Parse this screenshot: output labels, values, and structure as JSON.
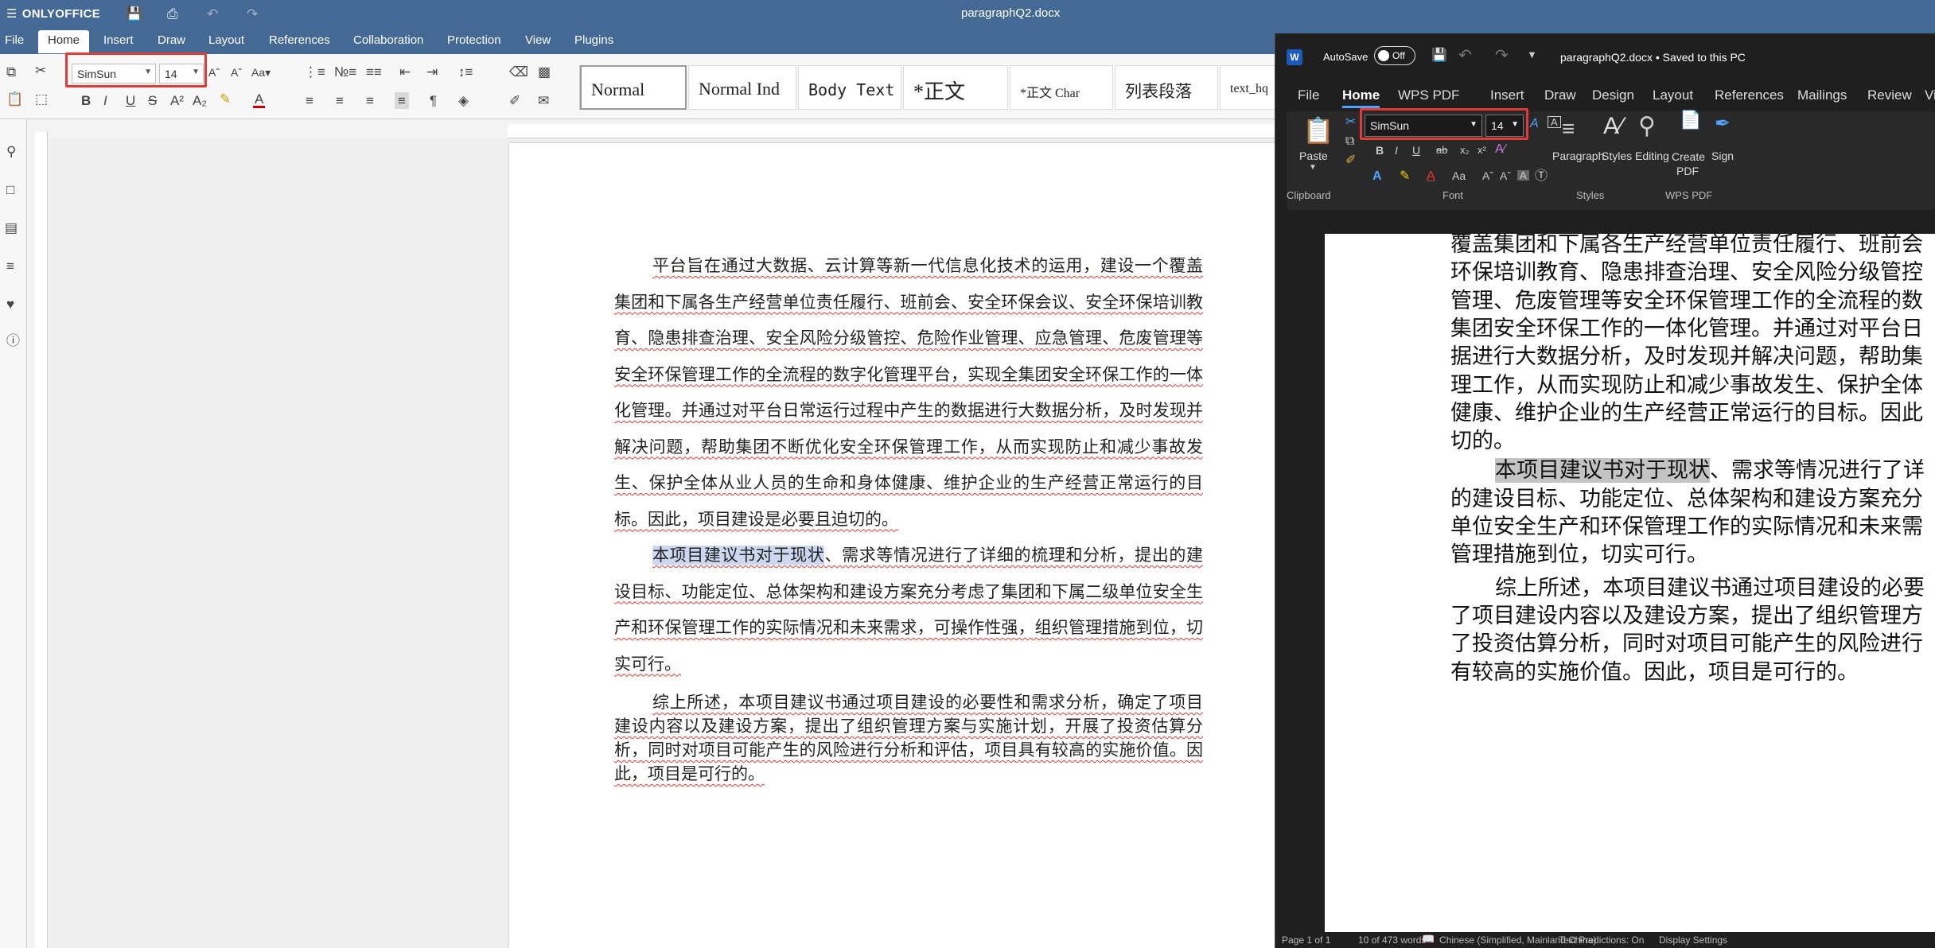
{
  "onlyoffice": {
    "app_name": "ONLYOFFICE",
    "doc_title": "paragraphQ2.docx",
    "menu": [
      "File",
      "Home",
      "Insert",
      "Draw",
      "Layout",
      "References",
      "Collaboration",
      "Protection",
      "View",
      "Plugins"
    ],
    "font_name": "SimSun",
    "font_size": "14",
    "styles": [
      "Normal",
      "Normal Ind",
      "Body Text",
      "*正文",
      "*正文 Char",
      "列表段落",
      "text_hq"
    ],
    "paragraphs": [
      {
        "highlight": "",
        "text": "平台旨在通过大数据、云计算等新一代信息化技术的运用，建设一个覆盖集团和下属各生产经营单位责任履行、班前会、安全环保会议、安全环保培训教育、隐患排查治理、安全风险分级管控、危险作业管理、应急管理、危废管理等安全环保管理工作的全流程的数字化管理平台，实现全集团安全环保工作的一体化管理。并通过对平台日常运行过程中产生的数据进行大数据分析，及时发现并解决问题，帮助集团不断优化安全环保管理工作，从而实现防止和减少事故发生、保护全体从业人员的生命和身体健康、维护企业的生产经营正常运行的目标。因此，项目建设是必要且迫切的。"
      },
      {
        "highlight": "本项目建议书对于现状",
        "text": "、需求等情况进行了详细的梳理和分析，提出的建设目标、功能定位、总体架构和建设方案充分考虑了集团和下属二级单位安全生产和环保管理工作的实际情况和未来需求，可操作性强，组织管理措施到位，切实可行。"
      },
      {
        "highlight": "",
        "text": "综上所述，本项目建议书通过项目建设的必要性和需求分析，确定了项目建设内容以及建设方案，提出了组织管理方案与实施计划，开展了投资估算分析，同时对项目可能产生的风险进行分析和评估，项目具有较高的实施价值。因此，项目是可行的。"
      }
    ]
  },
  "word": {
    "autosave_label": "AutoSave",
    "autosave_state": "Off",
    "doc_title": "paragraphQ2.docx • Saved to this PC",
    "menu": [
      "File",
      "Home",
      "WPS PDF",
      "Insert",
      "Draw",
      "Design",
      "Layout",
      "References",
      "Mailings",
      "Review",
      "View"
    ],
    "font_name": "SimSun",
    "font_size": "14",
    "paste": "Paste",
    "paragraph": "Paragraph",
    "styles": "Styles",
    "editing": "Editing",
    "create_pdf": "Create PDF",
    "sign": "Sign",
    "groups": [
      "Clipboard",
      "Font",
      "Styles",
      "WPS PDF"
    ],
    "lines": [
      {
        "indent": false,
        "hl": "",
        "text": "覆盖集团和下属各生产经营单位责任履行、班前会"
      },
      {
        "indent": false,
        "hl": "",
        "text": "环保培训教育、隐患排查治理、安全风险分级管控"
      },
      {
        "indent": false,
        "hl": "",
        "text": "管理、危废管理等安全环保管理工作的全流程的数"
      },
      {
        "indent": false,
        "hl": "",
        "text": "集团安全环保工作的一体化管理。并通过对平台日"
      },
      {
        "indent": false,
        "hl": "",
        "text": "据进行大数据分析，及时发现并解决问题，帮助集"
      },
      {
        "indent": false,
        "hl": "",
        "text": "理工作，从而实现防止和减少事故发生、保护全体"
      },
      {
        "indent": false,
        "hl": "",
        "text": "健康、维护企业的生产经营正常运行的目标。因此"
      },
      {
        "indent": false,
        "hl": "",
        "text": "切的。"
      },
      {
        "indent": true,
        "hl": "本项目建议书对于现状",
        "text": "、需求等情况进行了详"
      },
      {
        "indent": false,
        "hl": "",
        "text": "的建设目标、功能定位、总体架构和建设方案充分"
      },
      {
        "indent": false,
        "hl": "",
        "text": "单位安全生产和环保管理工作的实际情况和未来需"
      },
      {
        "indent": false,
        "hl": "",
        "text": "管理措施到位，切实可行。"
      },
      {
        "indent": true,
        "hl": "",
        "text": "综上所述，本项目建议书通过项目建设的必要"
      },
      {
        "indent": false,
        "hl": "",
        "text": "了项目建设内容以及建设方案，提出了组织管理方"
      },
      {
        "indent": false,
        "hl": "",
        "text": "了投资估算分析，同时对项目可能产生的风险进行"
      },
      {
        "indent": false,
        "hl": "",
        "text": "有较高的实施价值。因此，项目是可行的。"
      }
    ],
    "status": {
      "page": "Page 1 of 1",
      "words": "10 of 473 words",
      "language": "Chinese (Simplified, Mainland China)",
      "predictions": "Text Predictions: On",
      "display": "Display Settings"
    }
  },
  "colors": {
    "onlyoffice_header": "#446995",
    "annotation_box": "#e53935",
    "word_accent": "#4fa3ff"
  }
}
